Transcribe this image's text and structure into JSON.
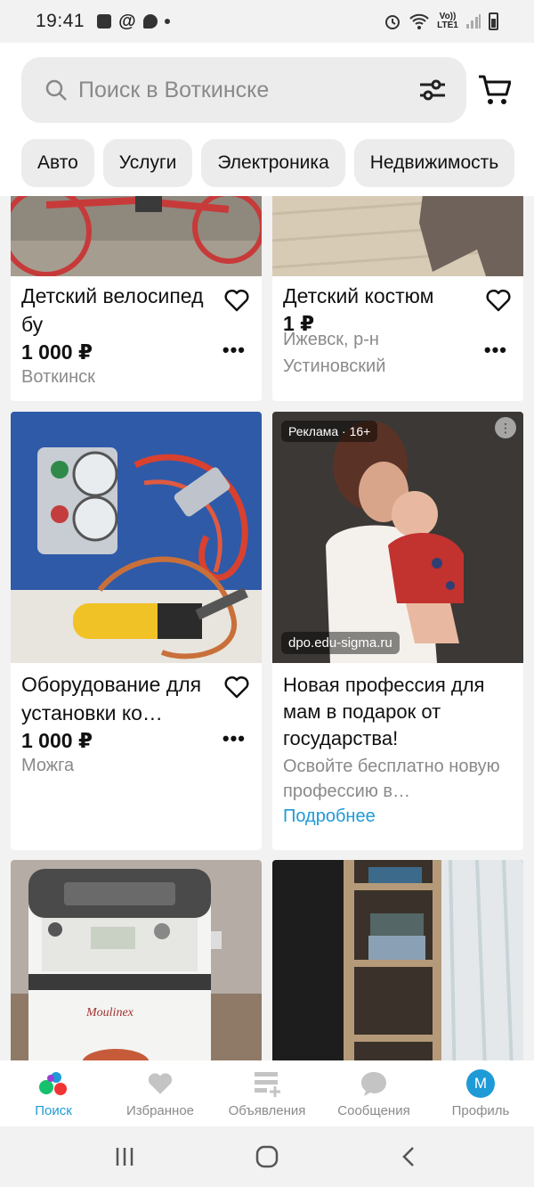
{
  "status_bar": {
    "time": "19:41",
    "network": "Vo)) LTE1"
  },
  "search": {
    "placeholder": "Поиск в Воткинске"
  },
  "categories": [
    "Авто",
    "Услуги",
    "Электроника",
    "Недвижимость"
  ],
  "listings": [
    {
      "title": "Детский велосипед бу",
      "price": "1 000 ₽",
      "location": "Воткинск"
    },
    {
      "title": "Детский костюм",
      "price": "1 ₽",
      "location": "Ижевск, р-н Устиновский"
    },
    {
      "title": "Оборудование для установки ко…",
      "price": "1 000 ₽",
      "location": "Можга"
    }
  ],
  "ad": {
    "badge": "Реклама · 16+",
    "domain": "dpo.edu-sigma.ru",
    "title": "Новая профессия для мам в подарок от государства!",
    "description": "Освойте бесплатно новую профессию в…",
    "link": "Подробнее"
  },
  "bottom_nav": [
    {
      "label": "Поиск",
      "icon": "search-dots-icon",
      "active": true
    },
    {
      "label": "Избранное",
      "icon": "heart-icon"
    },
    {
      "label": "Объявления",
      "icon": "listings-add-icon"
    },
    {
      "label": "Сообщения",
      "icon": "chat-icon"
    },
    {
      "label": "Профиль",
      "icon": "avatar",
      "avatar_letter": "M"
    }
  ],
  "colors": {
    "accent": "#1e9bd7",
    "background": "#f2f2f2",
    "muted_text": "#8a8a8a"
  }
}
